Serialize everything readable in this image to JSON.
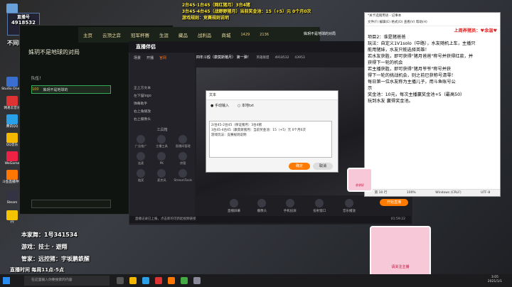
{
  "overlay": {
    "top_line1": "2台45-1台45（网红猪月）3台4猪",
    "top_line2": "3台45-4台45（战野野猪月）当前奖金池：15（+5）元 0个月0次",
    "top_line3": "游戏规则：竞赛规则说明",
    "left_badge": "直播号",
    "left_id": "4918532",
    "left_days": "不间断第16天",
    "bottom1": "本家舞：1号341534",
    "bottom2": "游戏：技士 · 遊翔",
    "bottom3": "管家：远控猪：宇坂鹏鉄醒",
    "bottom4": "直播时间 每周11点-5点"
  },
  "desktop_icons": [
    {
      "label": "回收站",
      "color": "#6aa0d8"
    },
    {
      "label": "Studio One 5",
      "color": "#3a6fd0"
    },
    {
      "label": "网易云音乐",
      "color": "#d33"
    },
    {
      "label": "腾讯QQ",
      "color": "#2aa0e8"
    },
    {
      "label": "QQ音乐",
      "color": "#f5b800"
    },
    {
      "label": "WeGame",
      "color": "#e24"
    },
    {
      "label": "斗鱼直播伴侣",
      "color": "#f70"
    },
    {
      "label": "Steam",
      "color": "#334"
    },
    {
      "label": "YY",
      "color": "#f4c400"
    }
  ],
  "game": {
    "nav": [
      "主页",
      "云顶之弈",
      "冠军杯赛",
      "生涯",
      "藏品",
      "战利品",
      "商城"
    ],
    "currency1": "1429",
    "currency2": "2136",
    "player_name": "姝玥不是地球的对局",
    "room_title": "姝玥不是地球的对局",
    "lobby_label": "队伍！",
    "member_level": "100",
    "member_name": "姝玥不是地球的"
  },
  "stream": {
    "app_title": "直播伴侣",
    "room_name": "四年斗殴（康莫斯猪月） 第一弹！",
    "room_tag": "英雄联盟",
    "room_num": "4918532",
    "room_fans": "43953",
    "tabs": [
      "场景",
      "开播",
      "官网"
    ],
    "sources": [
      "正上方文本",
      "左下猫logo",
      "弹幕助手",
      "右上角播放",
      "右上摄像头"
    ],
    "tools_title": "工具箱",
    "tools": [
      "广告推广",
      "主播工具",
      "直播间管理",
      "连麦",
      "PK",
      "房管",
      "抽奖",
      "麦克风",
      "StreamTools"
    ],
    "bottom_buttons": [
      "直播屏幕",
      "摄像头",
      "手机投屏",
      "投射窗口",
      "音乐播放"
    ],
    "start_label": "开始直播",
    "status_text": "直播记录已上报，点击新的可新起视频链接",
    "timer": "01:59:22"
  },
  "dialog": {
    "title": "文本",
    "radio1": "手动输入",
    "radio2": "本地txt",
    "line1": "2/台45-2台45（保证猪月）3台4猪",
    "line2": "3台45-4台45（康莫斯猪月）当前奖金池：15（+5）元 0个月0次",
    "line3": "游戏玩法：竞赛规则说明",
    "ok": "确定",
    "cancel": "取消"
  },
  "notepad": {
    "title": "*关卡选猪用语 - 记事本",
    "menu": [
      "文件(F)",
      "编辑(E)",
      "格式(O)",
      "查看(V)",
      "帮助(H)"
    ],
    "heart_line": "上周养猪员：♥余温♥",
    "lines": [
      "项目2：谁是猪爸爸",
      "玩法：自定义1V1solo（中路），水友随机上车，主播只",
      "能用猪妹，水友只能选择英雄！",
      "若水友获胜，即可获得\"猪月爸爸\"称号并获得红款，并",
      "获得下一轮的机会",
      "若主播获胜，即可获得\"猪月爷爷\"称号并获",
      "得下一轮的挑战机会，则之前已获称号清零！",
      "每日第一位水友称为主播儿子，用斗鱼账号公",
      "示",
      "",
      "奖金池：10元，每次主播赢奖金池+5（最高50）",
      "玩到水友 赢得奖金池。"
    ],
    "status": [
      "第 10 行",
      "100%",
      "Windows (CRLF)",
      "UTF-8"
    ]
  },
  "taskbar": {
    "search_placeholder": "在这里输入你要搜索的内容",
    "time": "3:05",
    "date": "2021/1/1"
  },
  "stickers": {
    "sticker1": "求求好",
    "sticker2": "请关注主播"
  }
}
